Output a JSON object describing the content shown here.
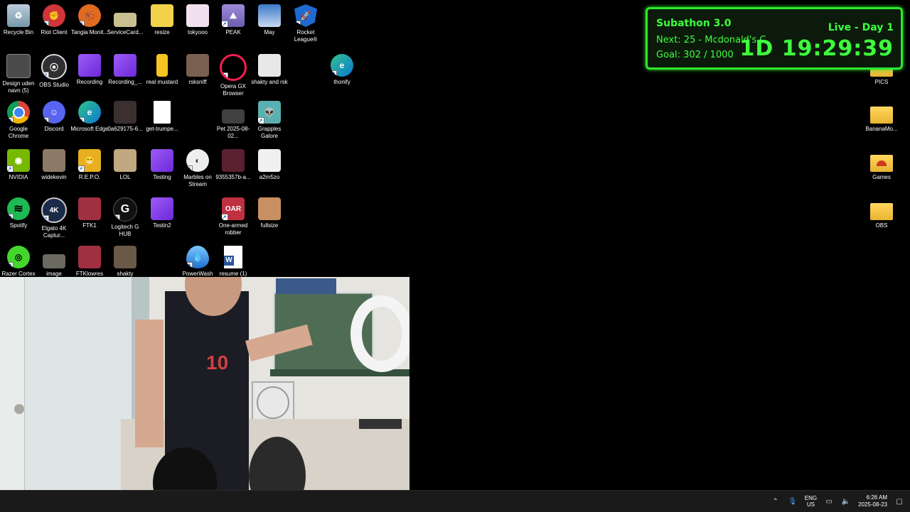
{
  "desktop_icons": [
    {
      "label": "Recycle Bin",
      "icon": "recycle-bin-icon"
    },
    {
      "label": "Riot Client",
      "icon": "riot-client-icon"
    },
    {
      "label": "Tangia Monit...",
      "icon": "tangia-icon"
    },
    {
      "label": "ServiceCard...",
      "icon": "image-thumb-icon"
    },
    {
      "label": "resize",
      "icon": "image-thumb-icon"
    },
    {
      "label": "tokyooo",
      "icon": "image-thumb-icon"
    },
    {
      "label": "PEAK",
      "icon": "peak-game-icon"
    },
    {
      "label": "May",
      "icon": "image-thumb-icon"
    },
    {
      "label": "Rocket League®",
      "icon": "rocket-league-icon"
    },
    {
      "label": "Design uden navn (5)",
      "icon": "image-thumb-icon"
    },
    {
      "label": "OBS Studio",
      "icon": "obs-icon"
    },
    {
      "label": "Recording",
      "icon": "clip-icon"
    },
    {
      "label": "Recording_...",
      "icon": "clip-icon"
    },
    {
      "label": "real mustard",
      "icon": "image-thumb-icon"
    },
    {
      "label": "rsksniff",
      "icon": "image-thumb-icon"
    },
    {
      "label": "Opera GX Browser",
      "icon": "opera-gx-icon"
    },
    {
      "label": "shakty and rsk",
      "icon": "image-thumb-icon"
    },
    {
      "label": "thonify",
      "icon": "edge-icon"
    },
    {
      "label": "Google Chrome",
      "icon": "chrome-icon"
    },
    {
      "label": "Discord",
      "icon": "discord-icon"
    },
    {
      "label": "Microsoft Edge",
      "icon": "edge-icon"
    },
    {
      "label": "0a629175-6...",
      "icon": "image-thumb-icon"
    },
    {
      "label": "get-trumpe...",
      "icon": "blank-file-icon"
    },
    {
      "label": "Pet 2025-08-02...",
      "icon": "image-thumb-icon"
    },
    {
      "label": "Grapples Galore",
      "icon": "game-icon"
    },
    {
      "label": "NVIDIA",
      "icon": "nvidia-icon"
    },
    {
      "label": "widekevin",
      "icon": "image-thumb-icon"
    },
    {
      "label": "R.E.P.O.",
      "icon": "game-icon"
    },
    {
      "label": "LOL",
      "icon": "image-thumb-icon"
    },
    {
      "label": "Testing",
      "icon": "clip-icon"
    },
    {
      "label": "Marbles on Stream",
      "icon": "game-icon"
    },
    {
      "label": "9355357b-a...",
      "icon": "image-thumb-icon"
    },
    {
      "label": "a2m5zo",
      "icon": "image-thumb-icon"
    },
    {
      "label": "Spotify",
      "icon": "spotify-icon"
    },
    {
      "label": "Elgato 4K Captur...",
      "icon": "elgato-icon"
    },
    {
      "label": "FTK1",
      "icon": "image-thumb-icon"
    },
    {
      "label": "Logitech G HUB",
      "icon": "logitech-icon"
    },
    {
      "label": "Testin2",
      "icon": "clip-icon"
    },
    {
      "label": "One-armed robber",
      "icon": "game-icon"
    },
    {
      "label": "fullsize",
      "icon": "image-thumb-icon"
    },
    {
      "label": "Razer Cortex",
      "icon": "razer-icon"
    },
    {
      "label": "image",
      "icon": "image-thumb-icon"
    },
    {
      "label": "FTKlowres",
      "icon": "image-thumb-icon"
    },
    {
      "label": "shakty",
      "icon": "image-thumb-icon"
    },
    {
      "label": "PowerWash",
      "icon": "powerwash-icon"
    },
    {
      "label": "resume (1)",
      "icon": "word-doc-icon"
    },
    {
      "label": "PICS",
      "icon": "folder-icon"
    },
    {
      "label": "BananaMo...",
      "icon": "folder-icon"
    },
    {
      "label": "Games",
      "icon": "folder-icon"
    },
    {
      "label": "OBS",
      "icon": "folder-icon"
    }
  ],
  "subathon": {
    "title": "Subathon 3.0",
    "next": "Next: 25 - Mcdonald's C",
    "goal": "Goal: 302 / 1000",
    "live": "Live - Day 1",
    "timer": "1D 19:29:39"
  },
  "taskbar": {
    "lang_line1": "ENG",
    "lang_line2": "US",
    "time": "6:26 AM",
    "date": "2025-08-23"
  },
  "colors": {
    "accent_green": "#3dff3d",
    "taskbar_bg": "#1a1a1a",
    "desktop_bg": "#000000"
  }
}
